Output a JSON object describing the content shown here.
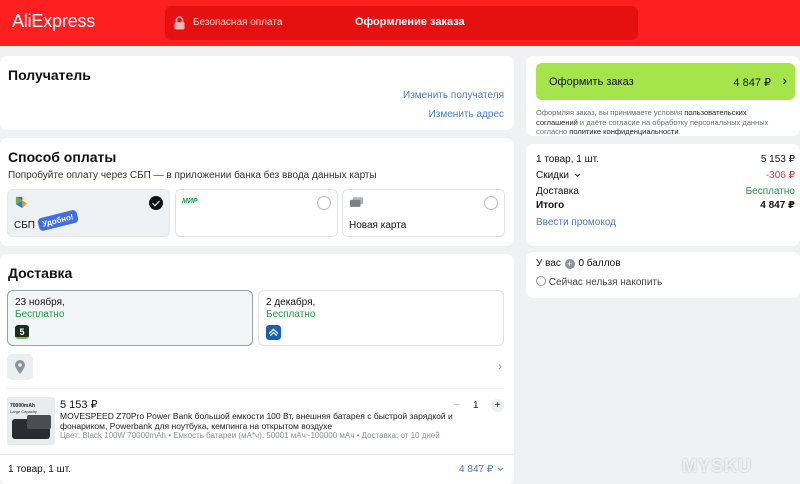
{
  "header": {
    "logo": "AliExpress",
    "secure_text": "Безопасная оплата",
    "checkout_title": "Оформление заказа"
  },
  "recipient": {
    "title": "Получатель",
    "change_recipient": "Изменить получателя",
    "change_address": "Изменить адрес"
  },
  "payment": {
    "title": "Способ оплаты",
    "hint": "Попробуйте оплату через СБП — в приложении банка без ввода данных карты",
    "options": [
      {
        "label": "СБП",
        "badge": "Удобно!",
        "selected": true
      },
      {
        "label": "",
        "logo": "МИР",
        "selected": false
      },
      {
        "label": "Новая карта",
        "selected": false
      }
    ]
  },
  "delivery": {
    "title": "Доставка",
    "options": [
      {
        "date": "23 ноября,",
        "price": "Бесплатно",
        "selected": true,
        "service_icon": "5"
      },
      {
        "date": "2 декабря,",
        "price": "Бесплатно",
        "selected": false
      }
    ],
    "item": {
      "price": "5 153 ₽",
      "title_line1": "MOVESPEED Z70Pro Power Bank большой емкости 100 Вт, внешняя батарея с быстрой зарядкой и",
      "title_line2": "фонариком, Powerbank для ноутбука, кемпинга на открытом воздухе",
      "specs": "Цвет: Black 100W 70000mAh • Емкость батареи (мА*ч): 50001 мАч~100000 мАч • Доставка: от 10 дней",
      "thumb_text1": "70000mAh",
      "thumb_text2": "Large Capacity",
      "qty": "1",
      "minus": "−",
      "plus": "+"
    },
    "footer_count": "1 товар, 1 шт.",
    "footer_total": "4 847 ₽"
  },
  "summary": {
    "order_button": "Оформить заказ",
    "order_total": "4 847 ₽",
    "agree_line1_a": "Оформляя заказ, вы принимаете условия ",
    "agree_line1_b": "пользовательских",
    "agree_line2_a": "соглашений",
    "agree_line2_b": " и даёте согласие на обработку персональных данных",
    "agree_line3_a": "согласно ",
    "agree_line3_b": "политике конфиденциальности",
    "agree_line3_c": ".",
    "rows": {
      "items_label": "1 товар, 1 шт.",
      "items_value": "5 153 ₽",
      "discount_label": "Скидки",
      "discount_value": "-306 ₽",
      "delivery_label": "Доставка",
      "delivery_value": "Бесплатно",
      "total_label": "Итого",
      "total_value": "4 847 ₽"
    },
    "promo_link": "Ввести промокод",
    "points_a": "У вас",
    "points_b": "0 баллов",
    "points_note": "Сейчас нельзя накопить"
  },
  "watermark": "MYSKU",
  "colors": {
    "header": "#fe2020",
    "order_button": "#a6e44b",
    "link": "#4a78c7",
    "free": "#1a9b3c",
    "discount": "#e53935"
  }
}
